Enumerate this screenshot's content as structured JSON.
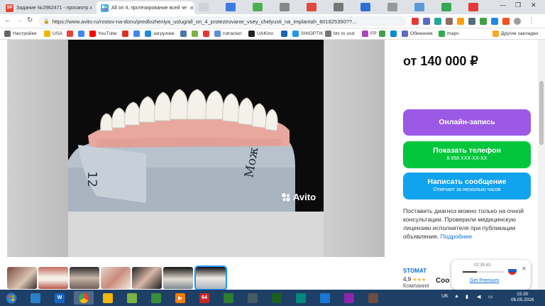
{
  "browser": {
    "tabs": [
      {
        "label": "Задание №2962471 - просмотр з",
        "icon": "sp-icon",
        "icon_text": "SP",
        "icon_color": "#e2452f",
        "active": false
      },
      {
        "label": "All on 4, протезирование всей че",
        "icon": "avito-icon",
        "icon_text": "",
        "icon_color": "#32b5e8",
        "active": true
      }
    ],
    "address": {
      "url": "https://www.avito.ru/rostov-na-donu/predlozheniya_uslug/all_on_4_protezirovanie_vsey_chelyusti_na_implantah_801825390??..."
    },
    "bookmarks": [
      {
        "label": "Настройки",
        "color": "#666666"
      },
      {
        "label": "USA",
        "color": "#f2b705"
      },
      {
        "label": "",
        "color": "#e8453c"
      },
      {
        "label": "",
        "color": "#4285f4"
      },
      {
        "label": "YouTube",
        "color": "#ff0000"
      },
      {
        "label": "",
        "color": "#d93025"
      },
      {
        "label": "",
        "color": "#4285f4"
      },
      {
        "label": "загрузчик",
        "color": "#1e88e5"
      },
      {
        "label": "",
        "color": "#4a76a8"
      },
      {
        "label": "",
        "color": "#7cb342"
      },
      {
        "label": "",
        "color": "#e53935"
      },
      {
        "label": "rutracker",
        "color": "#5b8fd6"
      },
      {
        "label": "UAKino",
        "color": "#222222"
      },
      {
        "label": "",
        "color": "#1565c0"
      },
      {
        "label": "SINOPTIK",
        "color": "#2196f3"
      },
      {
        "label": "btc to usd",
        "color": "#757575"
      },
      {
        "label": "FP",
        "color": "#ab47bc"
      },
      {
        "label": "",
        "color": "#43a047"
      },
      {
        "label": "",
        "color": "#0288d1"
      },
      {
        "label": "Обменник",
        "color": "#5c6bc0"
      },
      {
        "label": "maps",
        "color": "#34a853"
      },
      {
        "label": "Другие закладки",
        "color": "#f9a825"
      }
    ]
  },
  "listing": {
    "price": "от 140 000 ₽",
    "book_online": "Онлайн-запись",
    "show_phone": "Показать телефон",
    "phone_masked": "8 958 XXX-XX-XX",
    "send_message": "Написать сообщение",
    "reply_time": "Отвечает за несколько часов",
    "note": "Поставить диагноз можно только на очной консультации. Проверили медицинскую лицензию исполнителя при публикации объявления.",
    "note_link": "Подробнее",
    "watermark": "Avito",
    "model_label": "12",
    "model_label_2": "Мож"
  },
  "seller": {
    "name": "STOMAT",
    "rating": "4,9",
    "stars": 3,
    "type": "Компания",
    "cut_label": "Соо"
  },
  "player": {
    "time": "02:35:43",
    "premium": "Get Premium",
    "progress": 0.35
  },
  "taskbar": {
    "lang": "UK",
    "time": "15:30",
    "date": "06.05.2026",
    "badge": "64"
  },
  "colors": {
    "purple": "#9b59e6",
    "green": "#04c63d",
    "blue": "#12a3ee",
    "taskbar": "#1e3f66"
  }
}
